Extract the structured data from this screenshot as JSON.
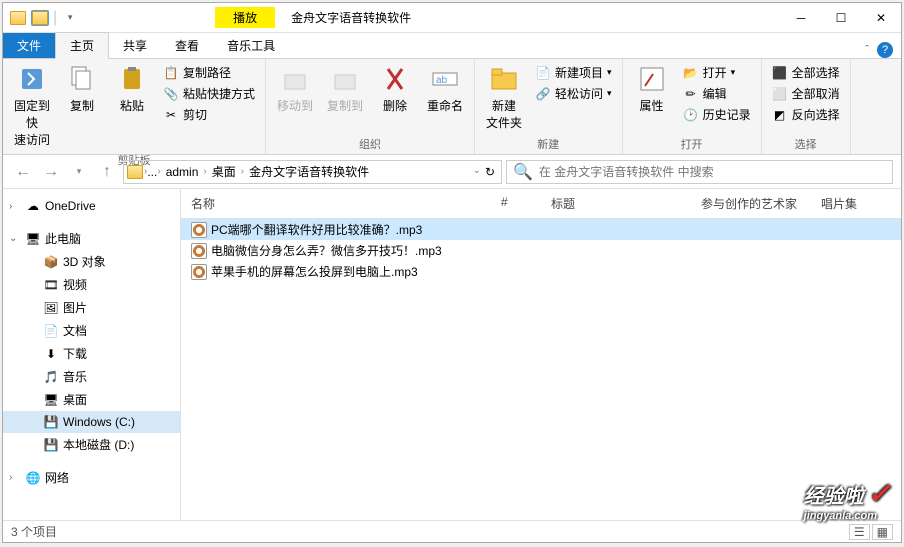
{
  "window": {
    "title": "金舟文字语音转换软件",
    "play_tab": "播放"
  },
  "tabs": {
    "file": "文件",
    "home": "主页",
    "share": "共享",
    "view": "查看",
    "music": "音乐工具"
  },
  "ribbon": {
    "pin": "固定到快\n速访问",
    "copy": "复制",
    "paste": "粘贴",
    "copy_path": "复制路径",
    "paste_shortcut": "粘贴快捷方式",
    "cut": "剪切",
    "clipboard_group": "剪贴板",
    "move_to": "移动到",
    "copy_to": "复制到",
    "delete": "删除",
    "rename": "重命名",
    "organize_group": "组织",
    "new_folder": "新建\n文件夹",
    "new_item": "新建项目",
    "easy_access": "轻松访问",
    "new_group": "新建",
    "properties": "属性",
    "open": "打开",
    "edit": "编辑",
    "history": "历史记录",
    "open_group": "打开",
    "select_all": "全部选择",
    "select_none": "全部取消",
    "invert_sel": "反向选择",
    "select_group": "选择"
  },
  "breadcrumb": {
    "item1": "admin",
    "item2": "桌面",
    "item3": "金舟文字语音转换软件"
  },
  "search": {
    "placeholder": "在 金舟文字语音转换软件 中搜索"
  },
  "tree": {
    "onedrive": "OneDrive",
    "thispc": "此电脑",
    "objects3d": "3D 对象",
    "videos": "视频",
    "pictures": "图片",
    "documents": "文档",
    "downloads": "下载",
    "music": "音乐",
    "desktop": "桌面",
    "c_drive": "Windows (C:)",
    "d_drive": "本地磁盘 (D:)",
    "network": "网络"
  },
  "columns": {
    "name": "名称",
    "number": "#",
    "title": "标题",
    "artists": "参与创作的艺术家",
    "album": "唱片集"
  },
  "files": [
    {
      "name": "PC端哪个翻译软件好用比较准确？.mp3",
      "selected": true
    },
    {
      "name": "电脑微信分身怎么弄？微信多开技巧！.mp3",
      "selected": false
    },
    {
      "name": "苹果手机的屏幕怎么投屏到电脑上.mp3",
      "selected": false
    }
  ],
  "status": {
    "items": "3 个项目"
  },
  "watermark": {
    "cn": "经验啦",
    "url": "jingyanla.com"
  }
}
